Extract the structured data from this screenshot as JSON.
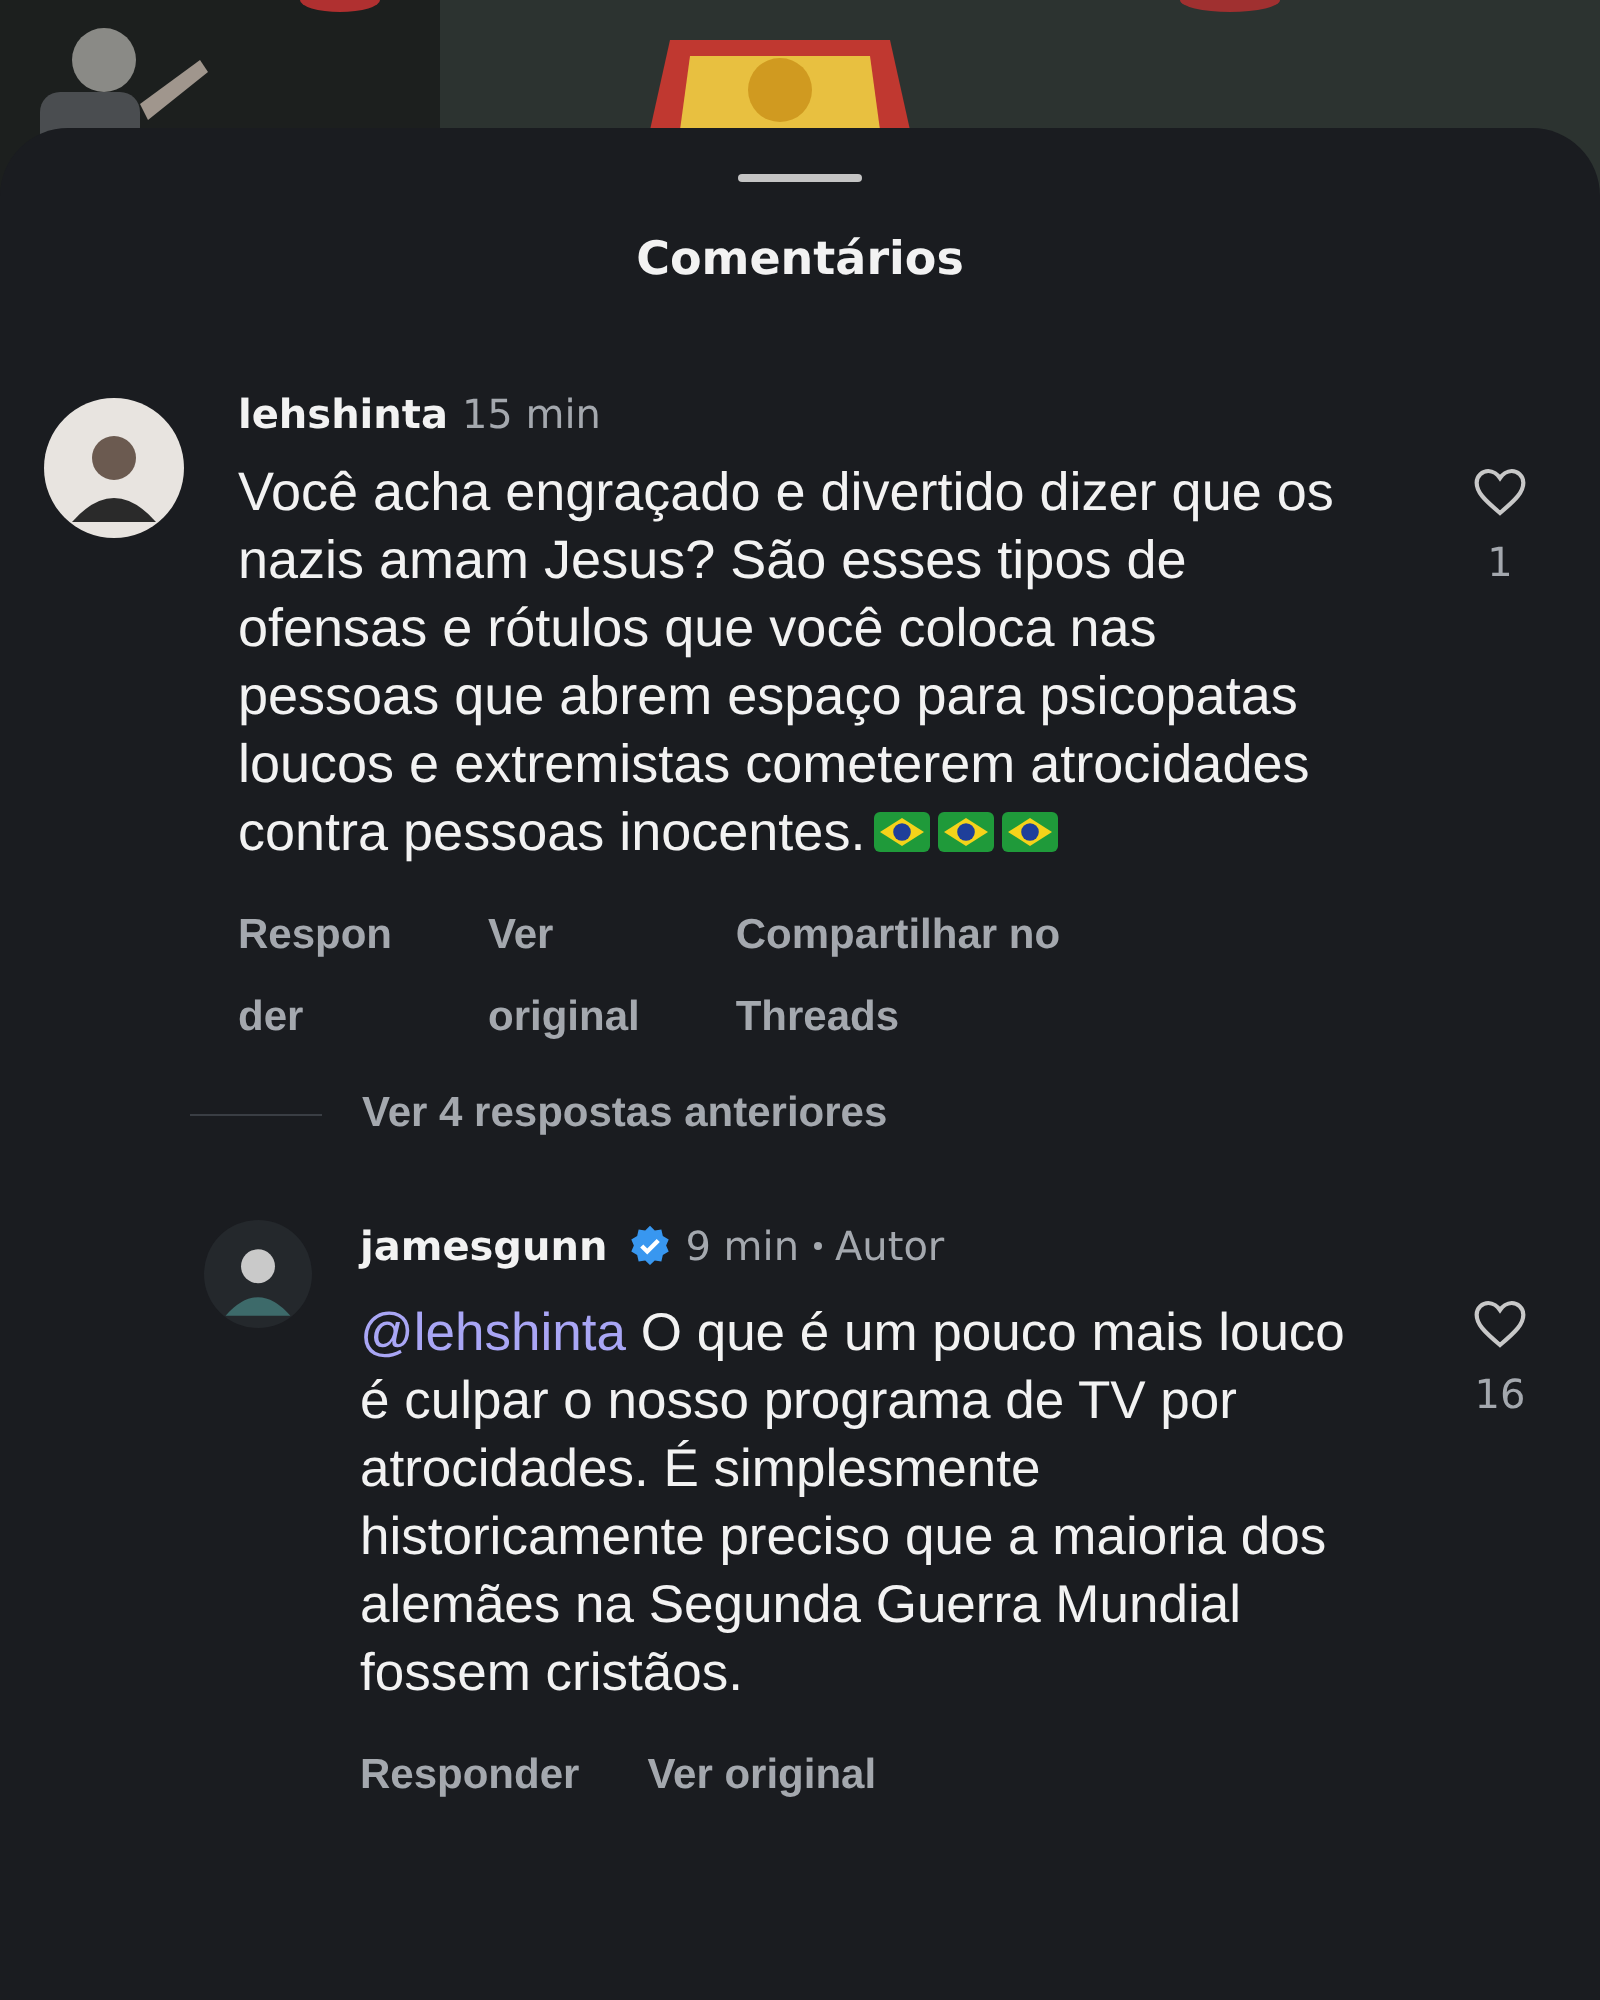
{
  "sheet": {
    "title": "Comentários"
  },
  "comments": [
    {
      "kind": "comment",
      "username": "lehshinta",
      "verified": false,
      "time": "15 min",
      "text": "Você acha engraçado e divertido dizer que os nazis amam Jesus? São esses tipos de ofensas e rótulos que você coloca nas pessoas que abrem espaço para psicopatas loucos e extremistas cometerem atrocidades contra pessoas inocentes.",
      "emoji": [
        {
          "kind": "brazil-flag"
        },
        {
          "kind": "brazil-flag"
        },
        {
          "kind": "brazil-flag"
        }
      ],
      "likes": "1",
      "liked": false,
      "actions": [
        "Respon\nder",
        "Ver\noriginal",
        "Compartilhar no\nThreads"
      ]
    },
    {
      "kind": "more",
      "label": "Ver 4 respostas anteriores"
    },
    {
      "kind": "reply",
      "username": "jamesgunn",
      "verified": true,
      "time": "9 min",
      "author_tag": "Autor",
      "mention": "@lehshinta",
      "text": "O que é um pouco mais louco é culpar o nosso programa de TV por atrocidades. É simplesmente historicamente preciso que a maioria dos alemães na Segunda Guerra Mundial fossem cristãos.",
      "likes": "16",
      "liked": false,
      "actions": [
        "Responder",
        "Ver original"
      ]
    }
  ]
}
